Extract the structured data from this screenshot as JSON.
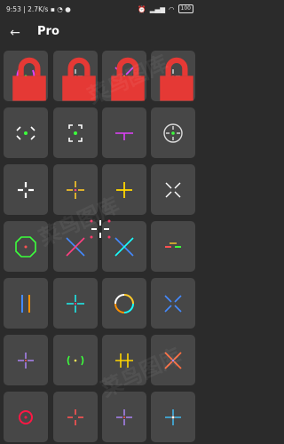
{
  "status_bar": {
    "time": "9:53",
    "network": "2.7K/s",
    "battery": "100"
  },
  "app_bar": {
    "title": "Pro"
  },
  "colors": {
    "background": "#2b2b2b",
    "tile": "#474747",
    "lock": "#e53935"
  },
  "crosshairs": [
    {
      "name": "rings-pink",
      "locked": true
    },
    {
      "name": "ticks-white",
      "locked": true
    },
    {
      "name": "x-pink",
      "locked": true
    },
    {
      "name": "ticks-white",
      "locked": true
    },
    {
      "name": "corners-white-green",
      "locked": false
    },
    {
      "name": "brackets-white-green",
      "locked": false
    },
    {
      "name": "t-pink",
      "locked": false
    },
    {
      "name": "circle-white-green",
      "locked": false
    },
    {
      "name": "plus-white",
      "locked": false
    },
    {
      "name": "plus-yellow-pink",
      "locked": false
    },
    {
      "name": "plus-yellow",
      "locked": false
    },
    {
      "name": "x-white",
      "locked": false
    },
    {
      "name": "octagon-green",
      "locked": false
    },
    {
      "name": "x-blue-pink",
      "locked": false
    },
    {
      "name": "x-blue-cyan",
      "locked": false
    },
    {
      "name": "dash-red-green",
      "locked": false
    },
    {
      "name": "bars-blue-orange",
      "locked": false
    },
    {
      "name": "plus-cyan",
      "locked": false
    },
    {
      "name": "ring-multicolor",
      "locked": false
    },
    {
      "name": "x-blue",
      "locked": false
    },
    {
      "name": "plus-purple",
      "locked": false
    },
    {
      "name": "parens-green",
      "locked": false
    },
    {
      "name": "bars-yellow",
      "locked": false
    },
    {
      "name": "x-orange",
      "locked": false
    },
    {
      "name": "ring-red",
      "locked": false
    },
    {
      "name": "plus-red",
      "locked": false
    },
    {
      "name": "plus-purple",
      "locked": false
    },
    {
      "name": "plus-blue",
      "locked": false
    }
  ]
}
